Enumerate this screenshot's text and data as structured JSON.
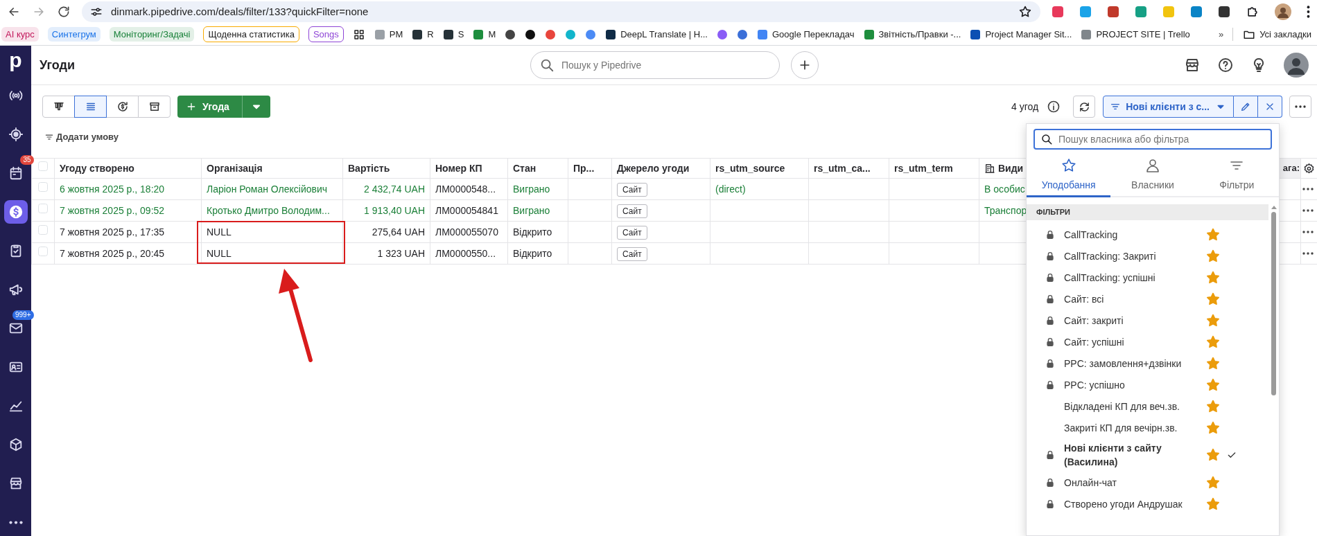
{
  "browser": {
    "url": "dinmark.pipedrive.com/deals/filter/133?quickFilter=none",
    "bookmarks": [
      {
        "kind": "chip",
        "label": "AI курс",
        "color": "#c2185b"
      },
      {
        "kind": "chip",
        "label": "Синтегрум",
        "color": "#1a73e8"
      },
      {
        "kind": "chip",
        "label": "Моніторинг/Задачі",
        "color": "#188038"
      },
      {
        "kind": "outline",
        "label": "Щоденна статистика",
        "color": "#f9ab00"
      },
      {
        "kind": "outline",
        "label": "Songs",
        "color": "#8e44d6"
      },
      {
        "kind": "apps"
      },
      {
        "kind": "link",
        "label": "PM",
        "color": "#9aa0a6"
      },
      {
        "kind": "link",
        "label": "R",
        "color": "#263238"
      },
      {
        "kind": "link",
        "label": "S",
        "color": "#263238"
      },
      {
        "kind": "link",
        "label": "M",
        "color": "#1e8e3e"
      },
      {
        "kind": "icon",
        "color": "#444444"
      },
      {
        "kind": "icon",
        "color": "#111111"
      },
      {
        "kind": "icon",
        "color": "#e8453c"
      },
      {
        "kind": "icon",
        "color": "#12b5cb"
      },
      {
        "kind": "icon",
        "color": "#4c8bf5"
      },
      {
        "kind": "link",
        "label": "DeepL Translate | Н...",
        "color": "#0f2b46"
      },
      {
        "kind": "icon",
        "color": "#8a5cf6"
      },
      {
        "kind": "icon",
        "color": "#3b6fd8"
      },
      {
        "kind": "link",
        "label": "Google Перекладач",
        "color": "#4285f4"
      },
      {
        "kind": "link",
        "label": "Звітність/Правки -...",
        "color": "#1e8e3e"
      },
      {
        "kind": "link",
        "label": "Project Manager Sit...",
        "color": "#0b4fb3"
      },
      {
        "kind": "link",
        "label": "PROJECT SITE | Trello",
        "color": "#80868b"
      }
    ],
    "more": "»",
    "all_bookmarks": "Усі закладки"
  },
  "sidebar": {
    "logo": "p",
    "items": [
      {
        "selected": false
      },
      {
        "selected": false
      },
      {
        "selected": false,
        "badge": "35"
      },
      {
        "selected": true
      },
      {
        "selected": false
      },
      {
        "selected": false
      },
      {
        "selected": false,
        "badge": "999+"
      },
      {
        "selected": false
      },
      {
        "selected": false
      },
      {
        "selected": false
      },
      {
        "selected": false
      },
      {
        "selected": false
      }
    ]
  },
  "header": {
    "title": "Угоди",
    "search": {
      "placeholder": "Пошук у Pipedrive"
    }
  },
  "toolbar": {
    "views": [
      {
        "kind": "pipeline",
        "selected": false
      },
      {
        "kind": "list",
        "selected": true
      },
      {
        "kind": "forecast",
        "selected": false
      },
      {
        "kind": "archive",
        "selected": false
      }
    ],
    "add_button": "Угода",
    "count": "4 угод",
    "filter_button": "Нові клієнти з с...",
    "add_condition": "Додати умову"
  },
  "table": {
    "all_checked": false,
    "columns": [
      "Угоду створено",
      "Організація",
      "Вартість",
      "Номер КП",
      "Стан",
      "Пр...",
      "Джерело угоди",
      "rs_utm_source",
      "rs_utm_ca...",
      "rs_utm_term",
      "Види",
      "ага:"
    ],
    "rows": [
      {
        "checked": false,
        "won": true,
        "cells": [
          "6 жовтня 2025 р., 18:20",
          "Ларіон Роман Олексійович",
          "2 432,74 UAH",
          "ЛМ0000548...",
          "Виграно",
          "",
          "Сайт",
          "(direct)",
          "",
          "",
          "В особис"
        ]
      },
      {
        "checked": false,
        "won": true,
        "cells": [
          "7 жовтня 2025 р., 09:52",
          "Кротько Дмитро Володим...",
          "1 913,40 UAH",
          "ЛМ000054841",
          "Виграно",
          "",
          "Сайт",
          "",
          "",
          "",
          "Транспор"
        ]
      },
      {
        "checked": false,
        "won": false,
        "cells": [
          "7 жовтня 2025 р., 17:35",
          "NULL",
          "275,64 UAH",
          "ЛМ000055070",
          "Відкрито",
          "",
          "Сайт",
          "",
          "",
          "",
          ""
        ]
      },
      {
        "checked": false,
        "won": false,
        "cells": [
          "7 жовтня 2025 р., 20:45",
          "NULL",
          "1 323 UAH",
          "ЛМ0000550...",
          "Відкрито",
          "",
          "Сайт",
          "",
          "",
          "",
          ""
        ]
      }
    ]
  },
  "dropdown": {
    "search": {
      "placeholder": "Пошук власника або фільтра"
    },
    "tabs": [
      {
        "label": "Уподобання",
        "selected": true
      },
      {
        "label": "Власники",
        "selected": false
      },
      {
        "label": "Фільтри",
        "selected": false
      }
    ],
    "section": "ФІЛЬТРИ",
    "items": [
      {
        "label": "CallTracking",
        "locked": true,
        "favorite": true,
        "selected": false
      },
      {
        "label": "CallTracking: Закриті",
        "locked": true,
        "favorite": true,
        "selected": false
      },
      {
        "label": "CallTracking: успішні",
        "locked": true,
        "favorite": true,
        "selected": false
      },
      {
        "label": "Сайт: всі",
        "locked": true,
        "favorite": true,
        "selected": false
      },
      {
        "label": "Сайт: закриті",
        "locked": true,
        "favorite": true,
        "selected": false
      },
      {
        "label": "Сайт: успішні",
        "locked": true,
        "favorite": true,
        "selected": false
      },
      {
        "label": "PPC: замовлення+дзвінки",
        "locked": true,
        "favorite": true,
        "selected": false
      },
      {
        "label": "PPC: успішно",
        "locked": true,
        "favorite": true,
        "selected": false
      },
      {
        "label": "Відкладені КП для веч.зв.",
        "locked": false,
        "favorite": true,
        "selected": false
      },
      {
        "label": "Закриті КП для вечірн.зв.",
        "locked": false,
        "favorite": true,
        "selected": false
      },
      {
        "label": "Нові клієнти з сайту (Василина)",
        "locked": true,
        "favorite": true,
        "selected": true
      },
      {
        "label": "Онлайн-чат",
        "locked": true,
        "favorite": true,
        "selected": false
      },
      {
        "label": "Створено угоди Андрушак",
        "locked": true,
        "favorite": true,
        "selected": false
      }
    ]
  },
  "annotations": [
    {
      "kind": "box"
    },
    {
      "kind": "arrow"
    }
  ]
}
